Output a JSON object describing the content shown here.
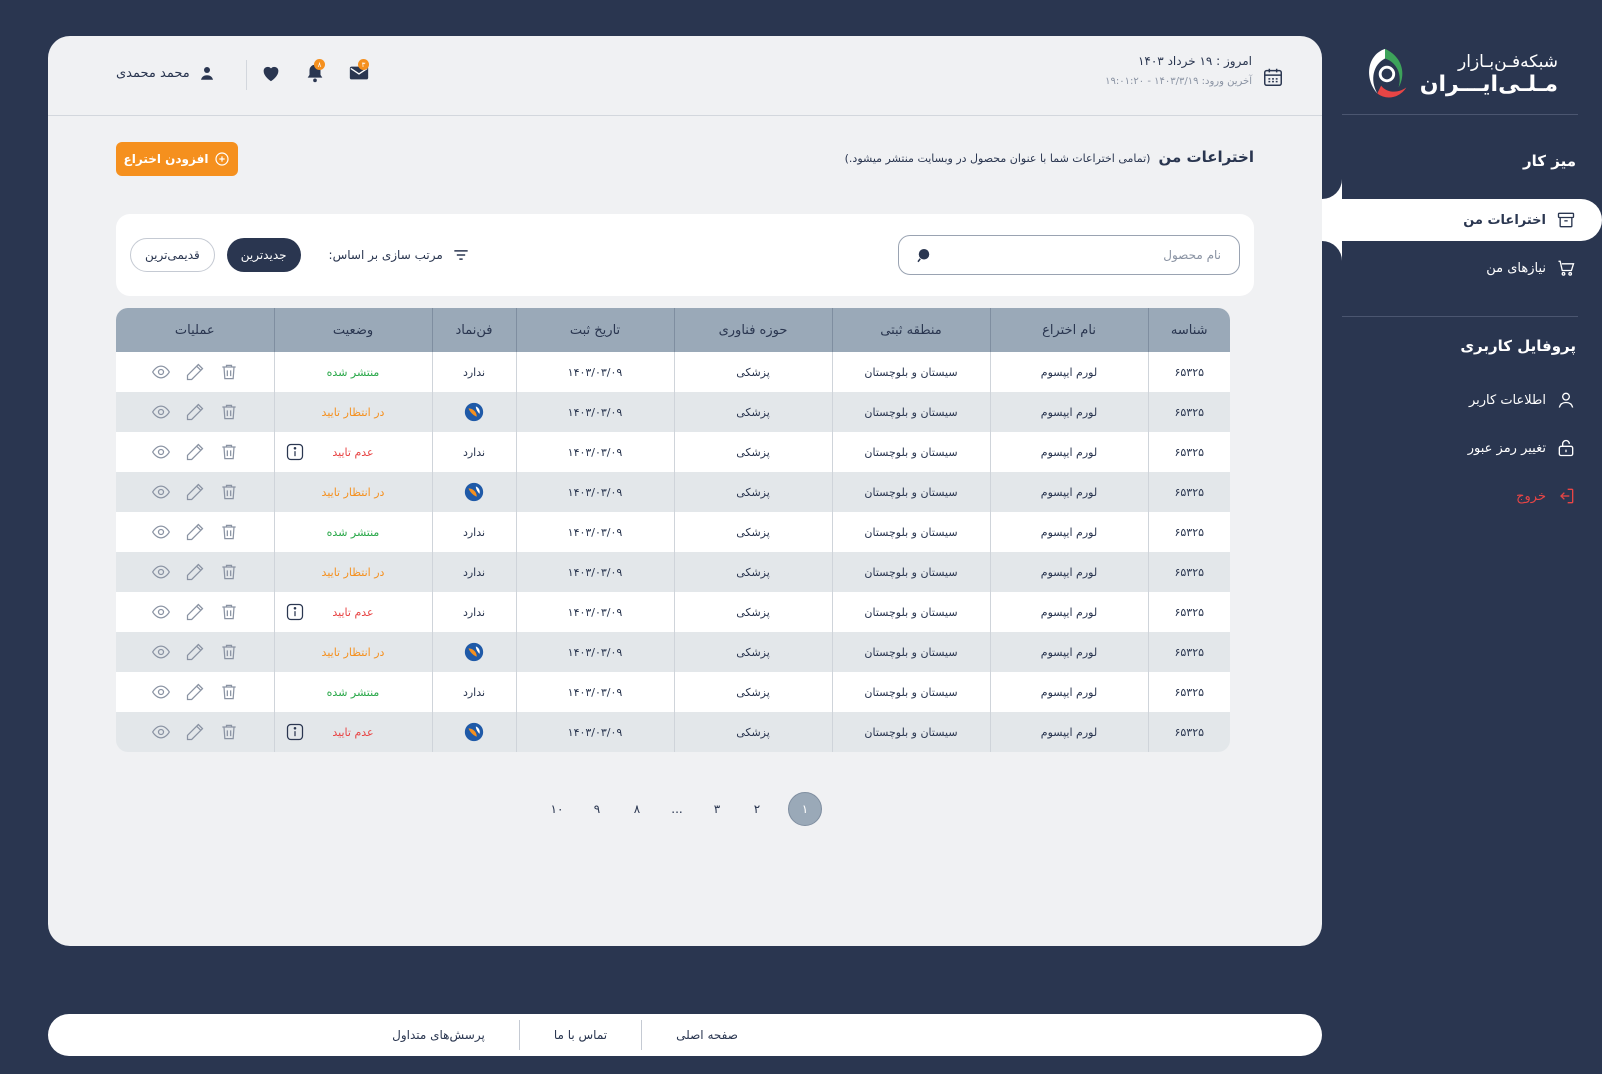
{
  "brand": {
    "line1": "شبکه‌فـن‌بـازار",
    "line2": "مـلـی‌ایـــران"
  },
  "sidebar": {
    "desk_title": "میز کار",
    "items": [
      {
        "label": "اختراعات من",
        "icon": "archive-icon"
      },
      {
        "label": "نیازهای من",
        "icon": "cart-icon"
      }
    ],
    "profile_title": "پروفایل کاربری",
    "profile_items": [
      {
        "label": "اطلاعات کاربر",
        "icon": "user-icon"
      },
      {
        "label": "تغییر رمز عبور",
        "icon": "lock-icon"
      },
      {
        "label": "خروج",
        "icon": "logout-icon"
      }
    ]
  },
  "header": {
    "today": "امروز : ۱۹ خرداد ۱۴۰۳",
    "last_login": "آخرین ورود: ۱۴۰۳/۳/۱۹ - ۱۹:۰۱:۲۰",
    "user_name": "محمد محمدی",
    "mail_badge": "۳",
    "bell_badge": "۸"
  },
  "page": {
    "title": "اختراعات من",
    "subtitle": "(تمامی اختراعات شما با عنوان محصول در وبسایت منتشر میشود.)",
    "add_button": "افزودن اختراع"
  },
  "filters": {
    "search_placeholder": "نام محصول",
    "sort_label": "مرتب سازی بر اساس:",
    "sort_newest": "جدیدترین",
    "sort_oldest": "قدیمی‌ترین"
  },
  "table": {
    "headers": [
      "شناسه",
      "نام اختراع",
      "منطقه ثبتی",
      "حوزه فناوری",
      "تاریخ ثبت",
      "فن‌نماد",
      "وضعیت",
      "عملیات"
    ],
    "rows": [
      {
        "id": "۶۵۳۲۵",
        "name": "لورم ایپسوم",
        "region": "سیستان و بلوچستان",
        "field": "پزشکی",
        "date": "۱۴۰۳/۰۳/۰۹",
        "symbol": "ندارد",
        "status": "منتشر شده",
        "status_type": "published"
      },
      {
        "id": "۶۵۳۲۵",
        "name": "لورم ایپسوم",
        "region": "سیستان و بلوچستان",
        "field": "پزشکی",
        "date": "۱۴۰۳/۰۳/۰۹",
        "symbol": "",
        "status": "در انتظار تایید",
        "status_type": "pending"
      },
      {
        "id": "۶۵۳۲۵",
        "name": "لورم ایپسوم",
        "region": "سیستان و بلوچستان",
        "field": "پزشکی",
        "date": "۱۴۰۳/۰۳/۰۹",
        "symbol": "ندارد",
        "status": "عدم تایید",
        "status_type": "rejected"
      },
      {
        "id": "۶۵۳۲۵",
        "name": "لورم ایپسوم",
        "region": "سیستان و بلوچستان",
        "field": "پزشکی",
        "date": "۱۴۰۳/۰۳/۰۹",
        "symbol": "",
        "status": "در انتظار تایید",
        "status_type": "pending"
      },
      {
        "id": "۶۵۳۲۵",
        "name": "لورم ایپسوم",
        "region": "سیستان و بلوچستان",
        "field": "پزشکی",
        "date": "۱۴۰۳/۰۳/۰۹",
        "symbol": "ندارد",
        "status": "منتشر شده",
        "status_type": "published"
      },
      {
        "id": "۶۵۳۲۵",
        "name": "لورم ایپسوم",
        "region": "سیستان و بلوچستان",
        "field": "پزشکی",
        "date": "۱۴۰۳/۰۳/۰۹",
        "symbol": "ندارد",
        "status": "در انتظار تایید",
        "status_type": "pending"
      },
      {
        "id": "۶۵۳۲۵",
        "name": "لورم ایپسوم",
        "region": "سیستان و بلوچستان",
        "field": "پزشکی",
        "date": "۱۴۰۳/۰۳/۰۹",
        "symbol": "ندارد",
        "status": "عدم تایید",
        "status_type": "rejected"
      },
      {
        "id": "۶۵۳۲۵",
        "name": "لورم ایپسوم",
        "region": "سیستان و بلوچستان",
        "field": "پزشکی",
        "date": "۱۴۰۳/۰۳/۰۹",
        "symbol": "",
        "status": "در انتظار تایید",
        "status_type": "pending"
      },
      {
        "id": "۶۵۳۲۵",
        "name": "لورم ایپسوم",
        "region": "سیستان و بلوچستان",
        "field": "پزشکی",
        "date": "۱۴۰۳/۰۳/۰۹",
        "symbol": "ندارد",
        "status": "منتشر شده",
        "status_type": "published"
      },
      {
        "id": "۶۵۳۲۵",
        "name": "لورم ایپسوم",
        "region": "سیستان و بلوچستان",
        "field": "پزشکی",
        "date": "۱۴۰۳/۰۳/۰۹",
        "symbol": "",
        "status": "عدم تایید",
        "status_type": "rejected"
      }
    ]
  },
  "pagination": [
    "۱",
    "۲",
    "۳",
    "...",
    "۸",
    "۹",
    "۱۰"
  ],
  "pagination_active": "۱",
  "footer": {
    "links": [
      "صفحه اصلی",
      "تماس با ما",
      "پرسش‌های متداول"
    ]
  },
  "colors": {
    "navy": "#2a3650",
    "accent": "#f5901e",
    "published": "#2aa84a",
    "rejected": "#e84545",
    "table_header": "#9aa9b8"
  }
}
